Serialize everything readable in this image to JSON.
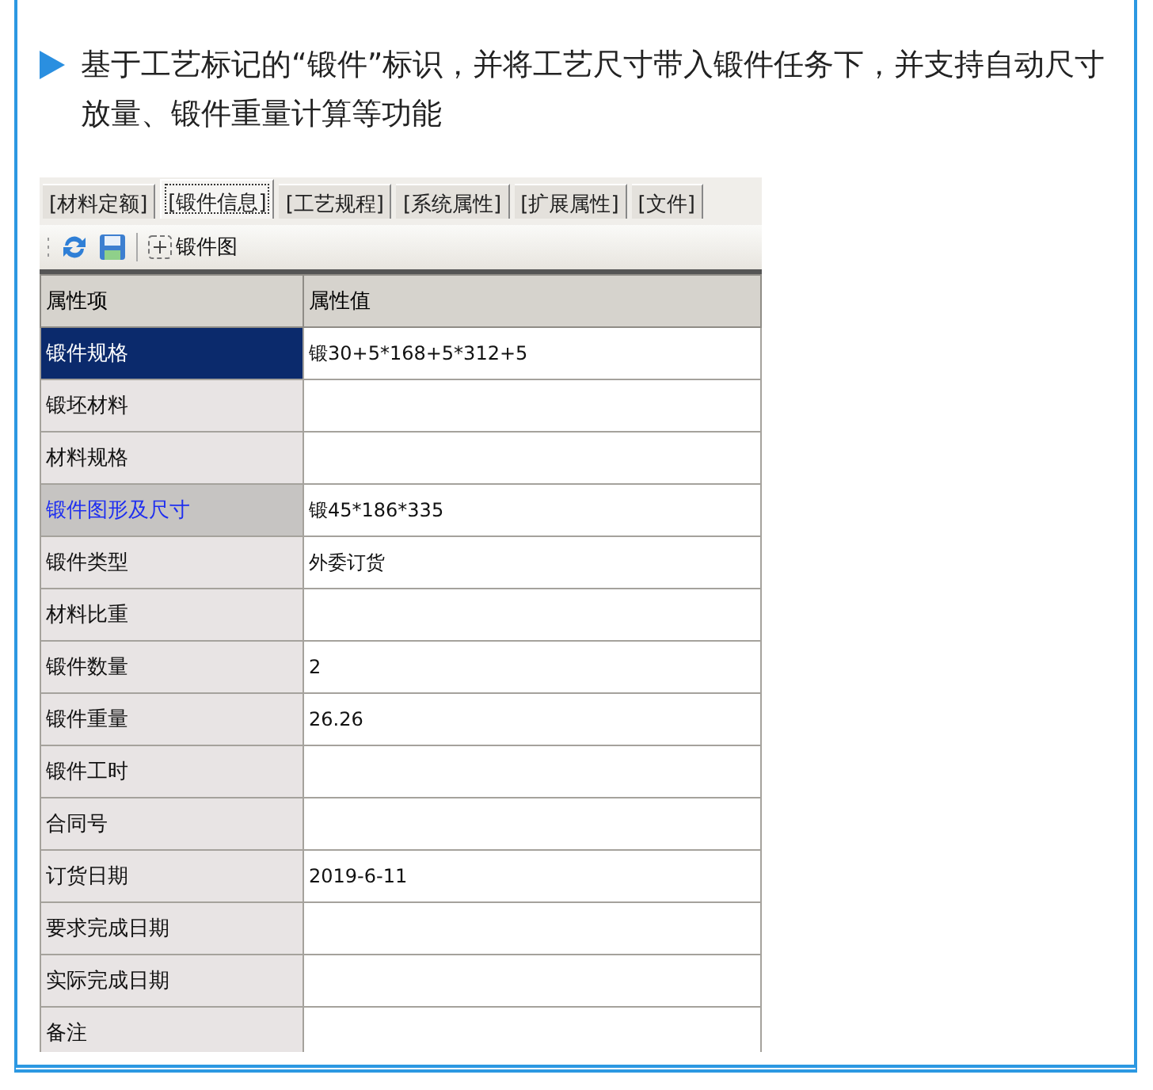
{
  "intro": {
    "text": "基于工艺标记的“锻件”标识，并将工艺尺寸带入锻件任务下，并支持自动尺寸放量、锻件重量计算等功能"
  },
  "tabs": [
    {
      "label": "[材料定额]",
      "selected": false
    },
    {
      "label": "[锻件信息]",
      "selected": true
    },
    {
      "label": "[工艺规程]",
      "selected": false
    },
    {
      "label": "[系统属性]",
      "selected": false
    },
    {
      "label": "[扩展属性]",
      "selected": false
    },
    {
      "label": "[文件]",
      "selected": false
    }
  ],
  "toolbar": {
    "drawing_button": "锻件图"
  },
  "table": {
    "columns": [
      "属性项",
      "属性值"
    ],
    "rows": [
      {
        "name": "锻件规格",
        "value": "锻30+5*168+5*312+5",
        "selected": true,
        "kind": "plain"
      },
      {
        "name": "锻坯材料",
        "value": "",
        "selected": false,
        "kind": "plain"
      },
      {
        "name": "材料规格",
        "value": "",
        "selected": false,
        "kind": "plain"
      },
      {
        "name": "锻件图形及尺寸",
        "value": "锻45*186*335",
        "selected": false,
        "kind": "link"
      },
      {
        "name": "锻件类型",
        "value": "外委订货",
        "selected": false,
        "kind": "plain"
      },
      {
        "name": "材料比重",
        "value": "",
        "selected": false,
        "kind": "plain"
      },
      {
        "name": "锻件数量",
        "value": "2",
        "selected": false,
        "kind": "plain"
      },
      {
        "name": "锻件重量",
        "value": "26.26",
        "selected": false,
        "kind": "plain"
      },
      {
        "name": "锻件工时",
        "value": "",
        "selected": false,
        "kind": "plain"
      },
      {
        "name": "合同号",
        "value": "",
        "selected": false,
        "kind": "plain"
      },
      {
        "name": "订货日期",
        "value": "2019-6-11",
        "selected": false,
        "kind": "plain"
      },
      {
        "name": "要求完成日期",
        "value": "",
        "selected": false,
        "kind": "plain"
      },
      {
        "name": "实际完成日期",
        "value": "",
        "selected": false,
        "kind": "plain"
      },
      {
        "name": "备注",
        "value": "",
        "selected": false,
        "kind": "plain"
      }
    ]
  }
}
